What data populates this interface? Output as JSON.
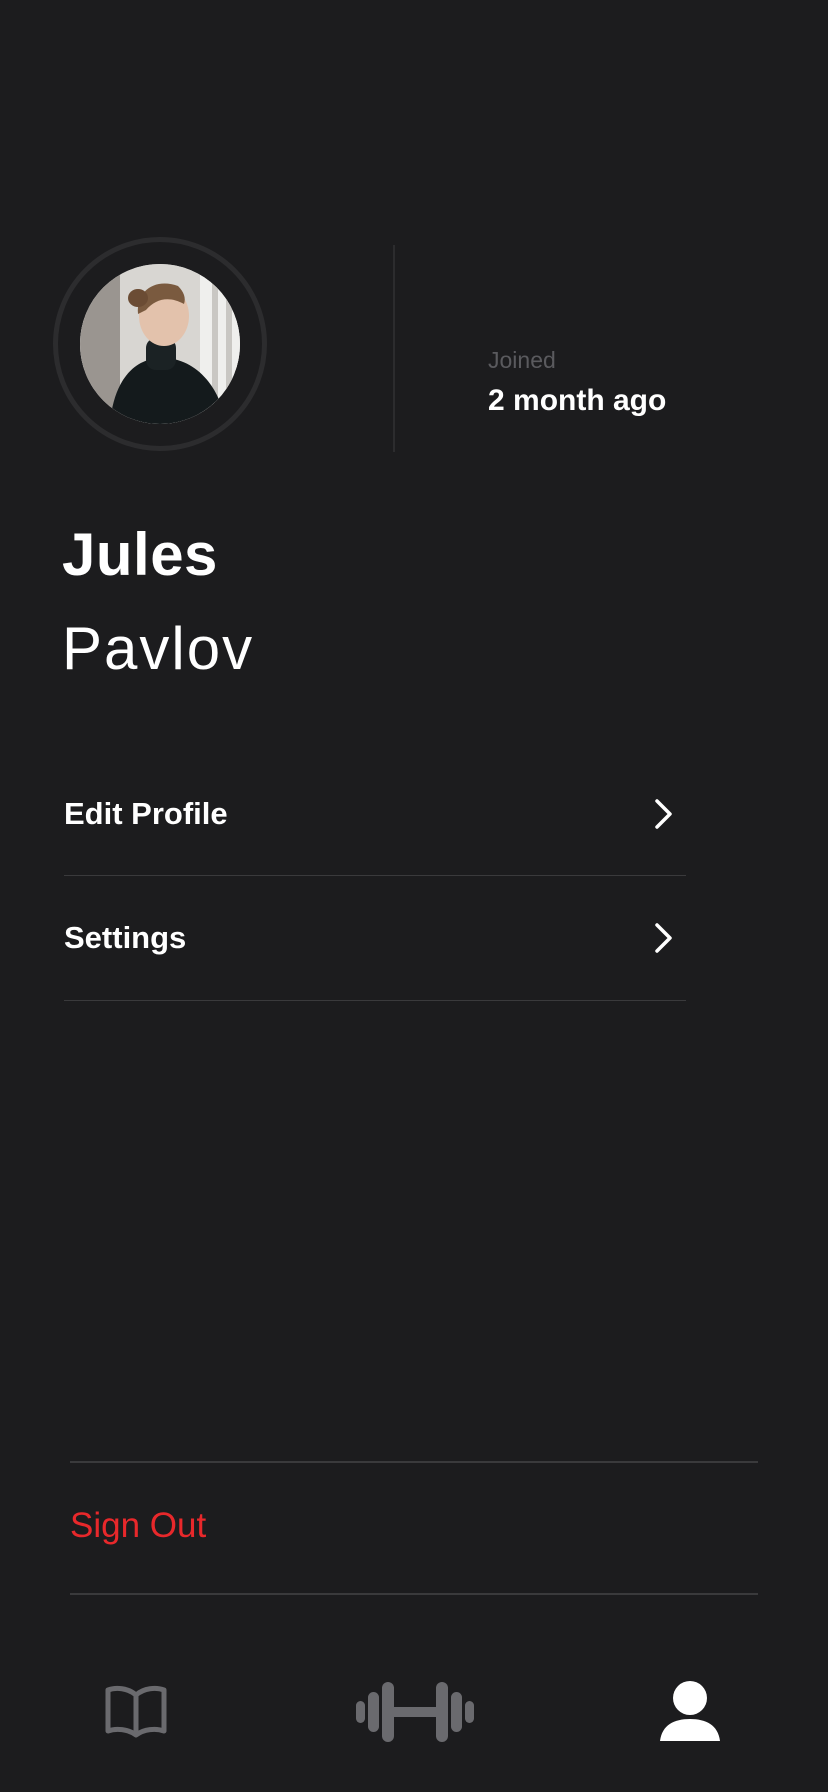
{
  "profile": {
    "first_name": "Jules",
    "last_name": "Pavlov",
    "joined_label": "Joined",
    "joined_value": "2 month ago"
  },
  "menu": {
    "items": [
      {
        "label": "Edit Profile",
        "icon": "chevron-right-icon"
      },
      {
        "label": "Settings",
        "icon": "chevron-right-icon"
      }
    ]
  },
  "sign_out_label": "Sign Out",
  "tab_bar": {
    "tabs": [
      {
        "icon": "book-icon",
        "active": false
      },
      {
        "icon": "dumbbell-icon",
        "active": false
      },
      {
        "icon": "person-icon",
        "active": true
      }
    ]
  },
  "colors": {
    "background": "#1c1c1e",
    "text": "#ffffff",
    "muted": "#5a5a5e",
    "divider": "#3a3a3c",
    "danger": "#e8282b",
    "inactive_tab": "#6a6a6e",
    "active_tab": "#ffffff"
  }
}
